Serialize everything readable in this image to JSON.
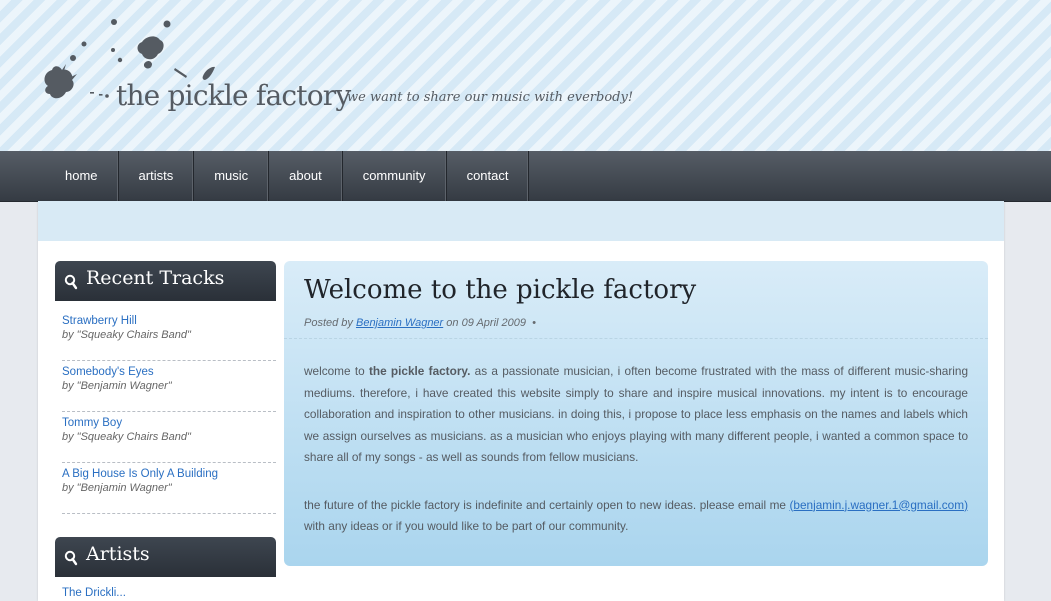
{
  "header": {
    "site_name": "the pickle factory",
    "tagline": "we want to share our music with everbody!"
  },
  "nav": {
    "items": [
      "home",
      "artists",
      "music",
      "about",
      "community",
      "contact"
    ]
  },
  "sidebar": {
    "recent_tracks": {
      "title": "Recent Tracks",
      "items": [
        {
          "title": "Strawberry Hill",
          "by": "by \"Squeaky Chairs Band\""
        },
        {
          "title": "Somebody's Eyes",
          "by": "by \"Benjamin Wagner\""
        },
        {
          "title": "Tommy Boy",
          "by": "by \"Squeaky Chairs Band\""
        },
        {
          "title": "A Big House Is Only A Building",
          "by": "by \"Benjamin Wagner\""
        }
      ]
    },
    "artists": {
      "title": "Artists",
      "first_item": "The Drickli..."
    }
  },
  "post": {
    "title": "Welcome to the pickle factory",
    "meta": {
      "posted_by": "Posted by",
      "author": "Benjamin Wagner",
      "on": "on 09 April 2009",
      "bullet": "•"
    },
    "p1": {
      "intro": "welcome to",
      "bold": "the pickle factory.",
      "rest": "as a passionate musician, i often become frustrated with the mass of different music-sharing mediums. therefore, i have created this website simply to share and inspire musical innovations. my intent is to encourage collaboration and inspiration to other musicians. in doing this, i propose to place less emphasis on the names and labels which we assign ourselves as musicians. as a musician who enjoys playing with many different people, i wanted a common space to share all of my songs - as well as sounds from fellow musicians."
    },
    "p2": {
      "text": "the future of the pickle factory is indefinite and certainly open to new ideas. please email me",
      "email": "(benjamin.j.wagner.1@gmail.com)",
      "after": "with any ideas or if you would like to be part of our community."
    }
  },
  "colors": {
    "header_bg": "#d6e9f6",
    "nav_bg": "#3e4550",
    "link": "#2a6fc2",
    "post_bg": "#bde0f3"
  },
  "icons": {
    "logo": "ink-splatter-logo",
    "box": "magnifier-icon"
  }
}
